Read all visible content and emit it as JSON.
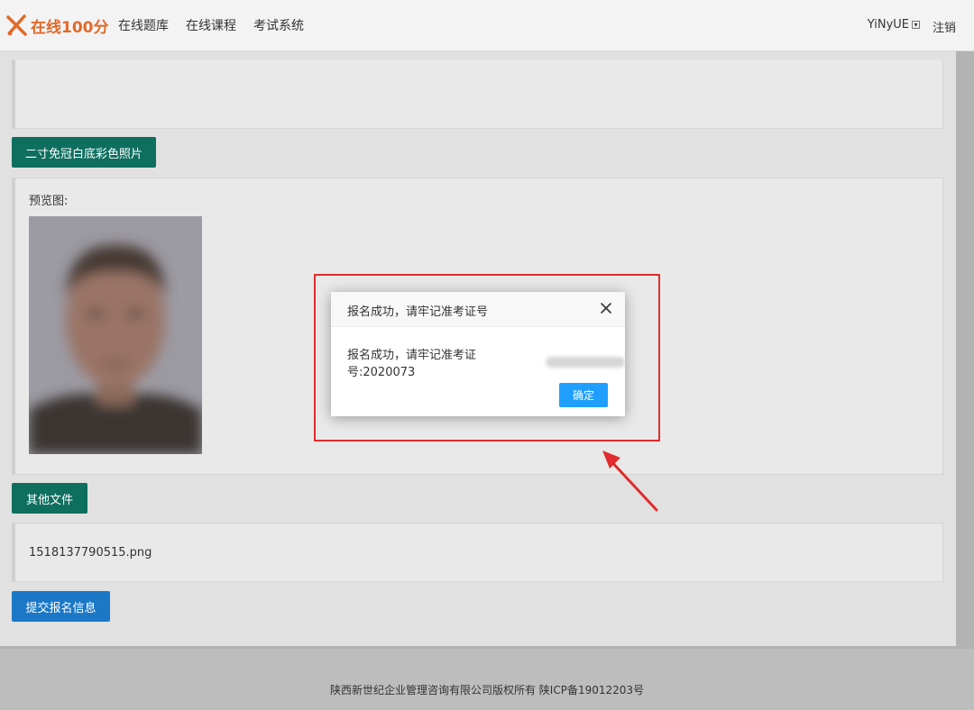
{
  "header": {
    "logo_text": "在线100分",
    "nav": [
      "在线题库",
      "在线课程",
      "考试系统"
    ],
    "user_name": "YiNyUE",
    "logout_label": "注销"
  },
  "form": {
    "photo_button_label": "二寸免冠白底彩色照片",
    "preview_label": "预览图:",
    "other_files_button_label": "其他文件",
    "uploaded_file": "1518137790515.png",
    "submit_button_label": "提交报名信息"
  },
  "dialog": {
    "title": "报名成功，请牢记准考证号",
    "message": "报名成功，请牢记准考证号:2020073",
    "ok_label": "确定"
  },
  "footer": {
    "text": "陕西新世纪企业管理咨询有限公司版权所有 陕ICP备19012203号"
  },
  "colors": {
    "accent_green": "#0e6f5f",
    "accent_blue": "#1b78c7",
    "dialog_button": "#1e9fff",
    "highlight_red": "#e02c2c",
    "logo_orange": "#e0692a"
  }
}
